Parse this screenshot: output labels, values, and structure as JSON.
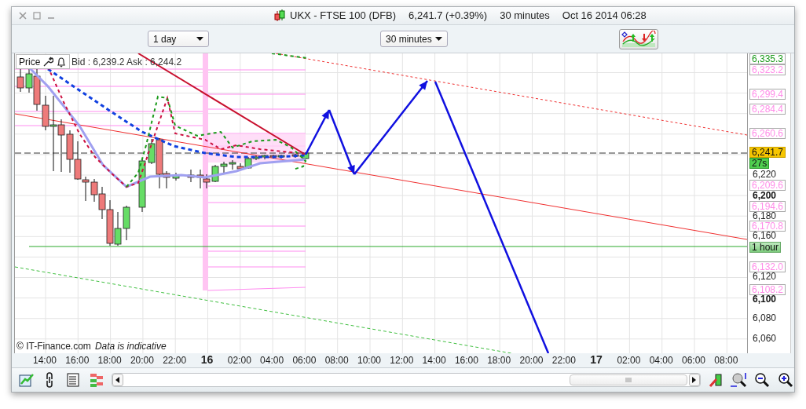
{
  "window": {
    "title": "UKX - FTSE 100 (DFB)",
    "price": "6,241.7 (+0.39%)",
    "interval": "30 minutes",
    "timestamp": "Oct 16 2014 06:28"
  },
  "toolbar": {
    "period": "1 day",
    "interval": "30 minutes"
  },
  "chart": {
    "legend": {
      "label": "Price",
      "quote": "Bid : 6,239.2 Ask : 6,244.2"
    },
    "credit": "© IT-Finance.com",
    "disclaimer": "Data is indicative",
    "price_labels": [
      {
        "text": "6,335.3",
        "kind": "top"
      },
      {
        "text": "6,323.2",
        "kind": "marker"
      },
      {
        "text": "6,299.4",
        "kind": "marker"
      },
      {
        "text": "6,284.4",
        "kind": "marker"
      },
      {
        "text": "6,260.6",
        "kind": "marker"
      },
      {
        "text": "6,241.7",
        "kind": "current"
      },
      {
        "text": "27s",
        "kind": "timer"
      },
      {
        "text": "6,220",
        "kind": "tick"
      },
      {
        "text": "6,209.6",
        "kind": "marker"
      },
      {
        "text": "6,200",
        "kind": "major"
      },
      {
        "text": "6,194.6",
        "kind": "marker"
      },
      {
        "text": "6,180",
        "kind": "tick"
      },
      {
        "text": "6,170.8",
        "kind": "marker"
      },
      {
        "text": "6,160",
        "kind": "tick"
      },
      {
        "text": "1 hour",
        "kind": "timeframe"
      },
      {
        "text": "6,132.0",
        "kind": "marker"
      },
      {
        "text": "6,120",
        "kind": "tick"
      },
      {
        "text": "6,108.2",
        "kind": "marker"
      },
      {
        "text": "6,100",
        "kind": "major"
      },
      {
        "text": "6,080",
        "kind": "tick"
      },
      {
        "text": "6,060",
        "kind": "tick"
      }
    ],
    "time_labels": [
      {
        "text": "14:00",
        "kind": "time"
      },
      {
        "text": "16:00",
        "kind": "time"
      },
      {
        "text": "18:00",
        "kind": "time"
      },
      {
        "text": "20:00",
        "kind": "time"
      },
      {
        "text": "22:00",
        "kind": "time"
      },
      {
        "text": "16",
        "kind": "day"
      },
      {
        "text": "02:00",
        "kind": "time"
      },
      {
        "text": "04:00",
        "kind": "time"
      },
      {
        "text": "06:00",
        "kind": "time"
      },
      {
        "text": "08:00",
        "kind": "time"
      },
      {
        "text": "10:00",
        "kind": "time"
      },
      {
        "text": "12:00",
        "kind": "time"
      },
      {
        "text": "14:00",
        "kind": "time"
      },
      {
        "text": "16:00",
        "kind": "time"
      },
      {
        "text": "18:00",
        "kind": "time"
      },
      {
        "text": "20:00",
        "kind": "time"
      },
      {
        "text": "22:00",
        "kind": "time"
      },
      {
        "text": "17",
        "kind": "day"
      },
      {
        "text": "02:00",
        "kind": "time"
      },
      {
        "text": "04:00",
        "kind": "time"
      },
      {
        "text": "06:00",
        "kind": "time"
      },
      {
        "text": "08:00",
        "kind": "time"
      }
    ]
  }
}
